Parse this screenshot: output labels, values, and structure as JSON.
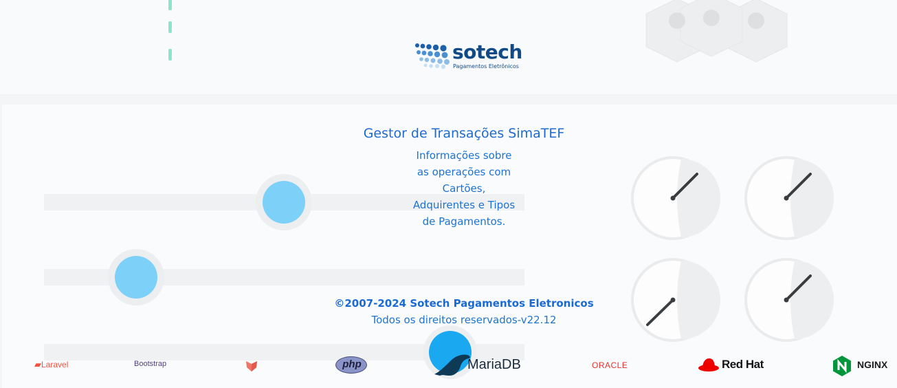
{
  "logo": {
    "name": "sotech",
    "tagline": "Pagamentos Eletrônicos"
  },
  "main": {
    "title": "Gestor de Transações SimaTEF",
    "description": "Informações sobre as operações com Cartões, Adquirentes e Tipos de Pagamentos.",
    "copyright": "©2007-2024 Sotech Pagamentos Eletronicos",
    "rights": "Todos os direitos reservados-v22.12"
  },
  "brands": {
    "laravel": "Laravel",
    "bootstrap": "Bootstrap",
    "php": "php",
    "mariadb": "MariaDB",
    "oracle": "ORACLE",
    "redhat": "Red Hat",
    "nginx": "NGINX"
  },
  "colors": {
    "brand_blue": "#114b87",
    "text_blue": "#1d6ad0",
    "knob": "#7dd0f7",
    "accent_teal": "#8fe3cc"
  }
}
